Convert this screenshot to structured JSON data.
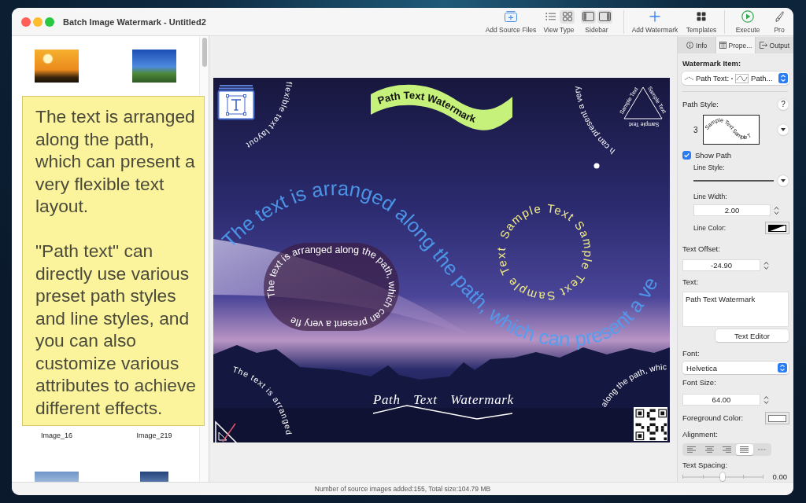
{
  "window": {
    "title": "Batch Image Watermark - Untitled2"
  },
  "toolbar": {
    "groups": [
      [
        {
          "kind": "button",
          "label": "Add Source Files"
        },
        {
          "kind": "segmented",
          "label": "View Type",
          "segments": [
            {
              "selected": false
            },
            {
              "selected": true
            }
          ]
        },
        {
          "kind": "segmented",
          "label": "Sidebar",
          "segments": [
            {
              "selected": true
            },
            {
              "selected": true
            }
          ]
        }
      ],
      [
        {
          "kind": "button",
          "label": "Add Watermark"
        },
        {
          "kind": "button",
          "label": "Templates"
        }
      ],
      [
        {
          "kind": "button",
          "label": "Execute"
        },
        {
          "kind": "button",
          "label": "Pro"
        }
      ]
    ]
  },
  "file_grid": {
    "cells": [
      {
        "kind": "thumbnail"
      },
      {
        "kind": "thumbnail"
      },
      {
        "kind": "caption",
        "label": "Image_16"
      },
      {
        "kind": "caption",
        "label": "Image_219"
      },
      {
        "kind": "thumbnail"
      },
      {
        "kind": "thumbnail"
      }
    ]
  },
  "tooltip": {
    "paragraphs": [
      "The text is arranged along the path, which can present a very flexible text layout.",
      "\"Path text\" can directly use various preset path styles and line styles, and you can also customize various attributes to achieve different effects."
    ]
  },
  "canvas": {
    "watermarks": [
      {
        "kind": "banner",
        "text": "Path Text Watermark"
      },
      {
        "kind": "wave",
        "text": "The text is arranged along the path, which can present a ve"
      },
      {
        "kind": "capsule",
        "text": "The text is arranged along the path, which can present a very fle"
      },
      {
        "kind": "ring",
        "text": "Sample Text Sample Text Sample Text"
      },
      {
        "kind": "border",
        "texts": [
          "The text is arranged",
          "along the path, whic",
          "h can present a very",
          "flexible text layout"
        ]
      },
      {
        "kind": "triangle",
        "texts": [
          "Sample Text",
          "Sample Text",
          "Sample Text"
        ]
      },
      {
        "kind": "script",
        "text": "Path Text Watermark"
      }
    ]
  },
  "inspector": {
    "tabs": [
      {
        "label": "Info",
        "selected": false
      },
      {
        "label": "Prope...",
        "selected": true
      },
      {
        "label": "Output",
        "selected": false
      }
    ],
    "watermark_item": {
      "label": "Watermark Item:",
      "type": "Path Text:",
      "value": "Path..."
    },
    "path_style": {
      "label": "Path Style:",
      "help": "?",
      "number": "3",
      "preview": "Sample Text Sample T"
    },
    "show_path": {
      "label": "Show Path",
      "checked": true
    },
    "line_style": {
      "label": "Line Style:"
    },
    "line_width": {
      "label": "Line Width:",
      "value": "2.00"
    },
    "line_color": {
      "label": "Line Color:"
    },
    "text_offset": {
      "label": "Text Offset:",
      "value": "-24.90"
    },
    "text": {
      "label": "Text:",
      "value": "Path Text Watermark"
    },
    "text_editor": {
      "label": "Text Editor"
    },
    "font": {
      "label": "Font:",
      "value": "Helvetica"
    },
    "font_size": {
      "label": "Font Size:",
      "value": "64.00"
    },
    "foreground_color": {
      "label": "Foreground Color:"
    },
    "alignment": {
      "label": "Alignment:",
      "options": [
        {
          "selected": false
        },
        {
          "selected": false
        },
        {
          "selected": false
        },
        {
          "selected": true
        },
        {
          "selected": false
        }
      ]
    },
    "text_spacing": {
      "label": "Text Spacing:",
      "level": 0.5,
      "reading": "0.00"
    }
  },
  "status_bar": {
    "text": "Number of source images added:155, Total size:104.79 MB"
  }
}
